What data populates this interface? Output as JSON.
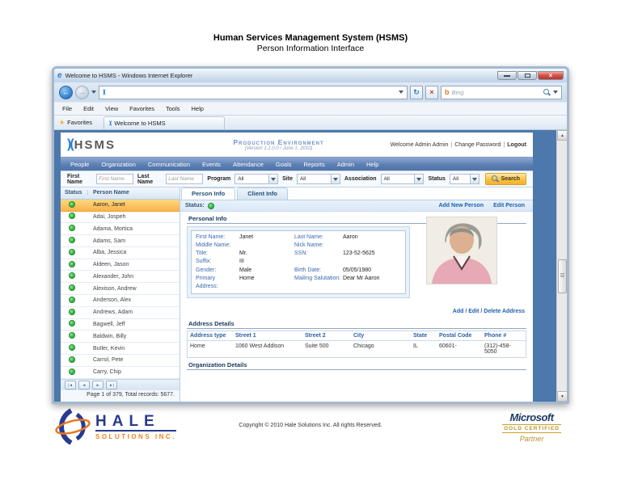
{
  "slide": {
    "title": "Human Services Management System (HSMS)",
    "subtitle": "Person Information Interface"
  },
  "browser": {
    "window_title": "Welcome to HSMS - Windows Internet Explorer",
    "menu": [
      "File",
      "Edit",
      "View",
      "Favorites",
      "Tools",
      "Help"
    ],
    "favorites_button": "Favorites",
    "tab_title": "Welcome to HSMS",
    "bing_placeholder": "Bing"
  },
  "icons": {
    "ie": "e",
    "close": "×",
    "back": "←",
    "forward": "→",
    "refresh": "↻",
    "stop": "×",
    "star": "★",
    "bing": "b",
    "glyph": ")(",
    "scroll_up": "▲",
    "scroll_down": "▼"
  },
  "app": {
    "logo_glyph": ")(",
    "logo_text": "HSMS",
    "environment": "Production Environment",
    "version": "(Version 1.1.0.0 / June 1, 2010)",
    "welcome": "Welcome Admin Admin",
    "change_password": "Change Password",
    "logout": "Logout",
    "nav": [
      "People",
      "Organization",
      "Communication",
      "Events",
      "Attendance",
      "Goals",
      "Reports",
      "Admin",
      "Help"
    ]
  },
  "filters": {
    "first_name": {
      "label": "First Name",
      "placeholder": "First Name"
    },
    "last_name": {
      "label": "Last Name",
      "placeholder": "Last Name"
    },
    "program": {
      "label": "Program",
      "value": "All"
    },
    "site": {
      "label": "Site",
      "value": "All"
    },
    "association": {
      "label": "Association",
      "value": "All"
    },
    "status": {
      "label": "Status",
      "value": "All"
    },
    "search": "Search"
  },
  "person_list": {
    "columns": [
      "Status",
      "Person Name"
    ],
    "rows": [
      "Aaron, Janet",
      "Adai, Jospeh",
      "Adama, Mortica",
      "Adams, Sam",
      "Alba, Jessica",
      "Aldeen, Jason",
      "Alexander, John",
      "Alexison, Andrew",
      "Anderson, Alex",
      "Andrews, Adam",
      "Bagwell, Jeff",
      "Baldwin, Billy",
      "Butler, Kevin",
      "Carrol, Pete",
      "Carry, Chip"
    ],
    "selected": "Aaron, Janet",
    "pager_icons": [
      "|◄",
      "◄",
      "►",
      "►|"
    ],
    "summary": "Page 1 of 379, Total records: 5677."
  },
  "detail": {
    "tabs": [
      "Person Info",
      "Client Info"
    ],
    "status_label": "Status:",
    "actions": {
      "add": "Add New Person",
      "edit": "Edit Person"
    },
    "personal_info": {
      "title": "Personal Info",
      "rows": [
        {
          "l": "First Name:",
          "lv": "Janet",
          "r": "Last Name:",
          "rv": "Aaron"
        },
        {
          "l": "Middle Name:",
          "lv": "",
          "r": "Nick Name:",
          "rv": ""
        },
        {
          "l": "Title:",
          "lv": "Mr.",
          "r": "SSN:",
          "rv": "123-52-5625"
        },
        {
          "l": "Suffix:",
          "lv": "III",
          "r": "",
          "rv": ""
        },
        {
          "l": "Gender:",
          "lv": "Male",
          "r": "Birth Date:",
          "rv": "05/05/1980"
        },
        {
          "l": "Primary Address:",
          "lv": "Home",
          "r": "Mailing Salutation:",
          "rv": "Dear Mr Aaron"
        }
      ]
    },
    "address_actions": "Add / Edit / Delete Address",
    "address_details": {
      "title": "Address Details",
      "columns": [
        "Address type",
        "Street 1",
        "Street 2",
        "City",
        "State",
        "Postal Code",
        "Phone #"
      ],
      "rows": [
        [
          "Home",
          "1060 West Addison",
          "Suite 500",
          "Chicago",
          "IL",
          "60601-",
          "(312)-458-5050"
        ]
      ]
    },
    "organization_details": {
      "title": "Organization Details"
    }
  },
  "footer": {
    "copyright": "Copyright © 2010 Hale Solutions Inc. All rights Reserved.",
    "hale_name": "HALE",
    "hale_sub": "SOLUTIONS INC.",
    "ms_brand": "Microsoft",
    "ms_cert": "GOLD CERTIFIED",
    "ms_partner": "Partner"
  },
  "colors": {
    "nav_blue": "#5c7fb4",
    "page_blue": "#4c78ab",
    "selected_row_orange": "#fbb34b",
    "status_green": "#3db54a",
    "link_blue": "#1f5fae",
    "search_gold": "#fcc23d",
    "close_red": "#c8403a",
    "hale_blue": "#283a8f",
    "hale_orange": "#f5821f",
    "ms_navy": "#1f3864",
    "ms_gold": "#b8912f"
  }
}
